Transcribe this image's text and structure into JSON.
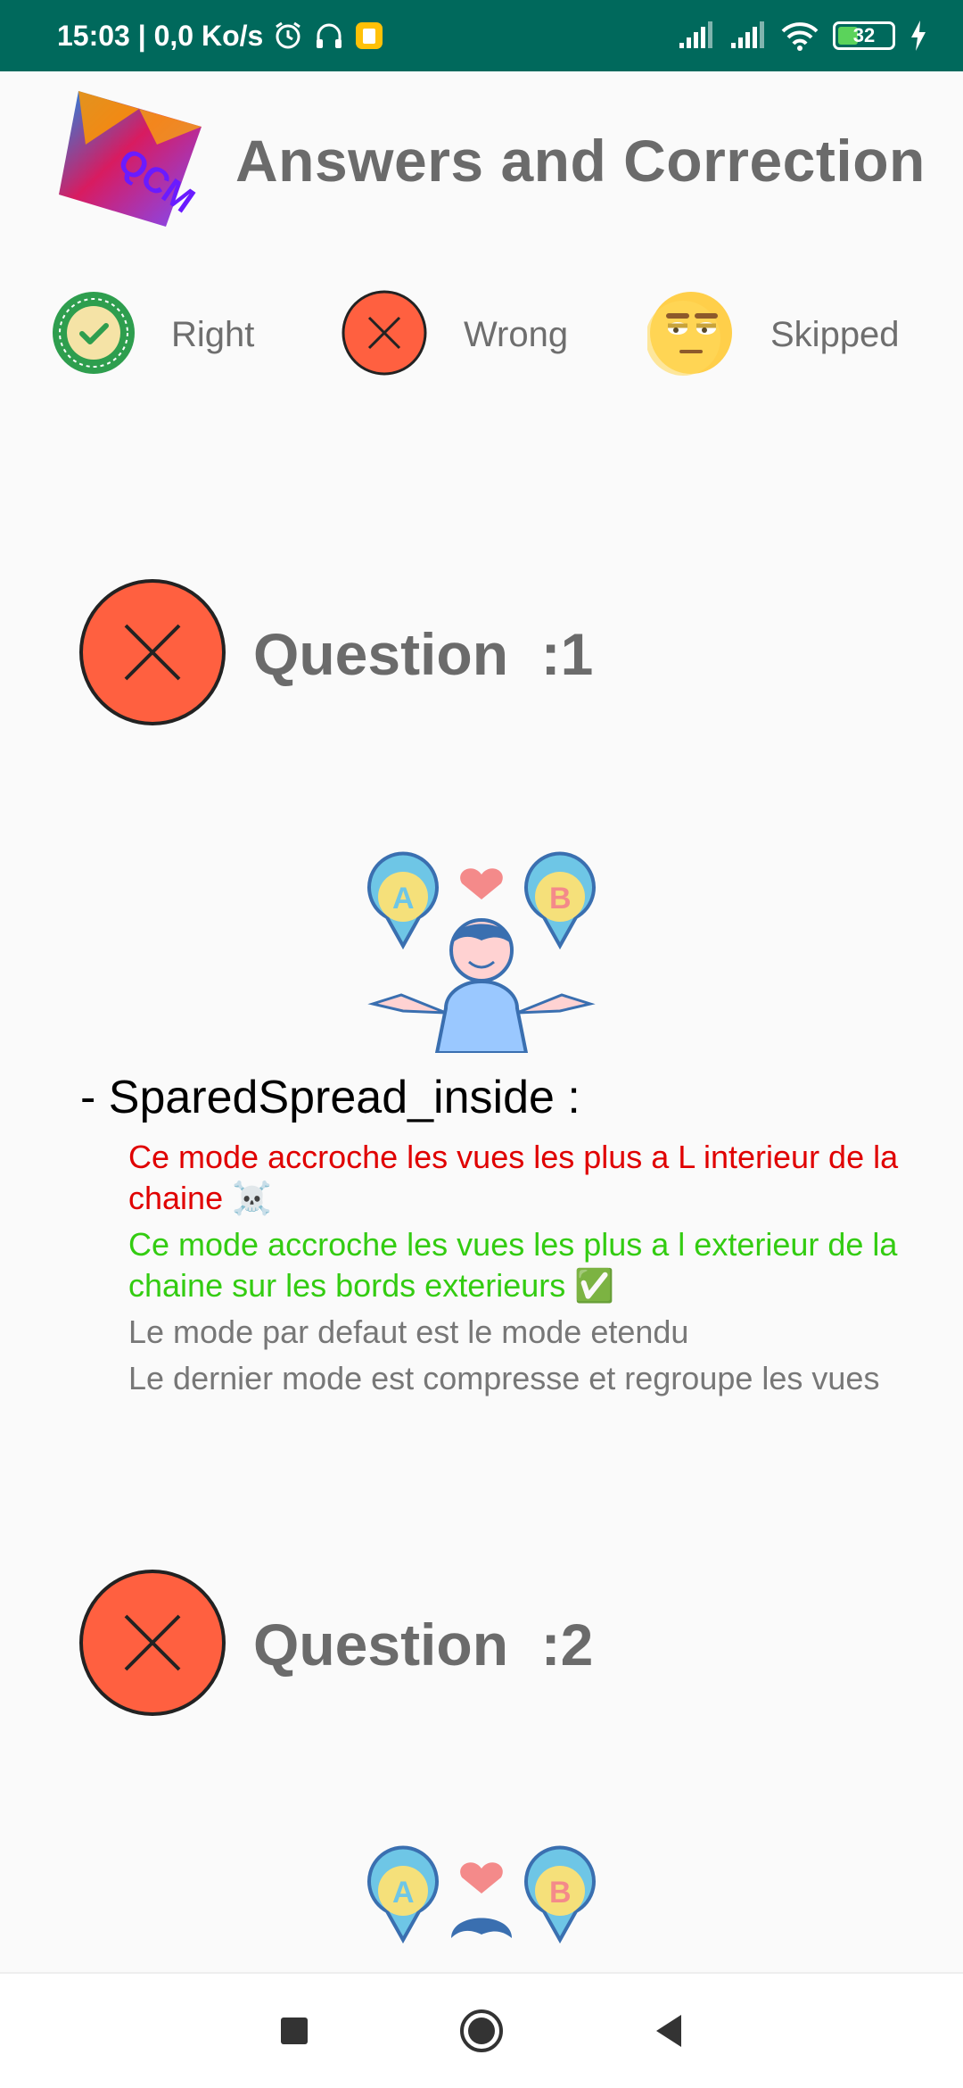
{
  "status_bar": {
    "time_speed": "15:03 | 0,0 Ko/s",
    "battery": "32",
    "icons": [
      "alarm-icon",
      "headset-icon",
      "notification-icon",
      "signal-icon",
      "signal-icon",
      "wifi-icon",
      "battery-icon",
      "charging-icon"
    ]
  },
  "header": {
    "logo_text": "QCM",
    "title": "Answers and Correction"
  },
  "legend": {
    "right": "Right",
    "wrong": "Wrong",
    "skipped": "Skipped"
  },
  "questions": [
    {
      "label": "Question  :1",
      "status": "wrong",
      "answer_title": "- SparedSpread_inside :",
      "lines": [
        {
          "text": "Ce mode accroche les vues les plus a L interieur de la chaine  ☠️",
          "kind": "wrong"
        },
        {
          "text": "Ce mode accroche les vues les plus a l exterieur de la chaine sur les bords exterieurs  ✅",
          "kind": "right"
        },
        {
          "text": "Le mode par defaut est le mode etendu",
          "kind": "neutral"
        },
        {
          "text": "Le dernier mode est compresse et regroupe les vues",
          "kind": "neutral"
        }
      ]
    },
    {
      "label": "Question  :2",
      "status": "wrong"
    }
  ],
  "colors": {
    "status_bar": "#00695c",
    "wrong_red": "#ff6040",
    "right_green": "#2e9e4e",
    "skipped_yellow": "#ffcf4a",
    "answer_wrong": "#e00000",
    "answer_right": "#33cc11"
  },
  "nav": {
    "icons": [
      "recent-apps-icon",
      "home-icon",
      "back-icon"
    ]
  }
}
